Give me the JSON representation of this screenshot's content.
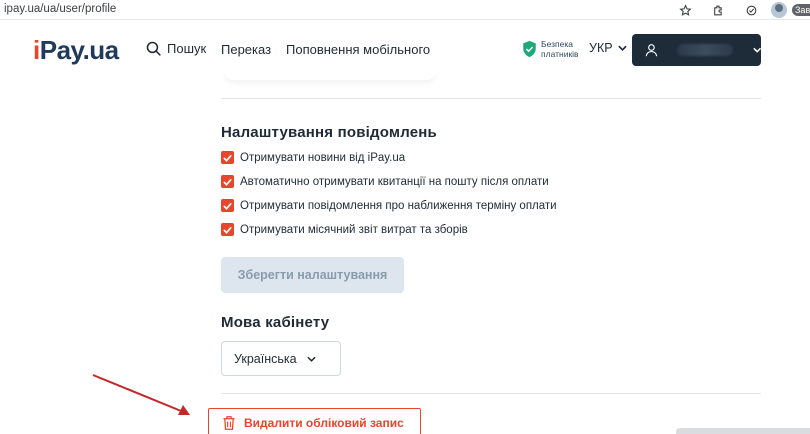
{
  "browser": {
    "url": "ipay.ua/ua/user/profile",
    "edge_label": "Зав",
    "icons": [
      "star-icon",
      "extensions-icon",
      "copilot-icon",
      "profile-icon"
    ]
  },
  "header": {
    "logo_first": "i",
    "logo_rest": "Pay.ua",
    "search_label": "Пошук",
    "nav": [
      "Переказ",
      "Поповнення мобільного"
    ],
    "security_line1": "Безпека",
    "security_line2": "платників",
    "lang": "УКР"
  },
  "notifications": {
    "title": "Налаштування повідомлень",
    "options": [
      {
        "label": "Отримувати новини від iPay.ua",
        "checked": true
      },
      {
        "label": "Автоматично отримувати квитанції на пошту після оплати",
        "checked": true
      },
      {
        "label": "Отримувати повідомлення про наближення терміну оплати",
        "checked": true
      },
      {
        "label": "Отримувати місячний звіт витрат та зборів",
        "checked": true
      }
    ],
    "save_label": "Зберегти налаштування"
  },
  "language": {
    "title": "Мова кабінету",
    "selected": "Українська"
  },
  "account": {
    "delete_label": "Видалити обліковий запис"
  },
  "colors": {
    "accent": "#e8452d",
    "dark": "#1e2b39",
    "disabled_button": "#dde5ee",
    "annotation_arrow": "#c62828"
  }
}
